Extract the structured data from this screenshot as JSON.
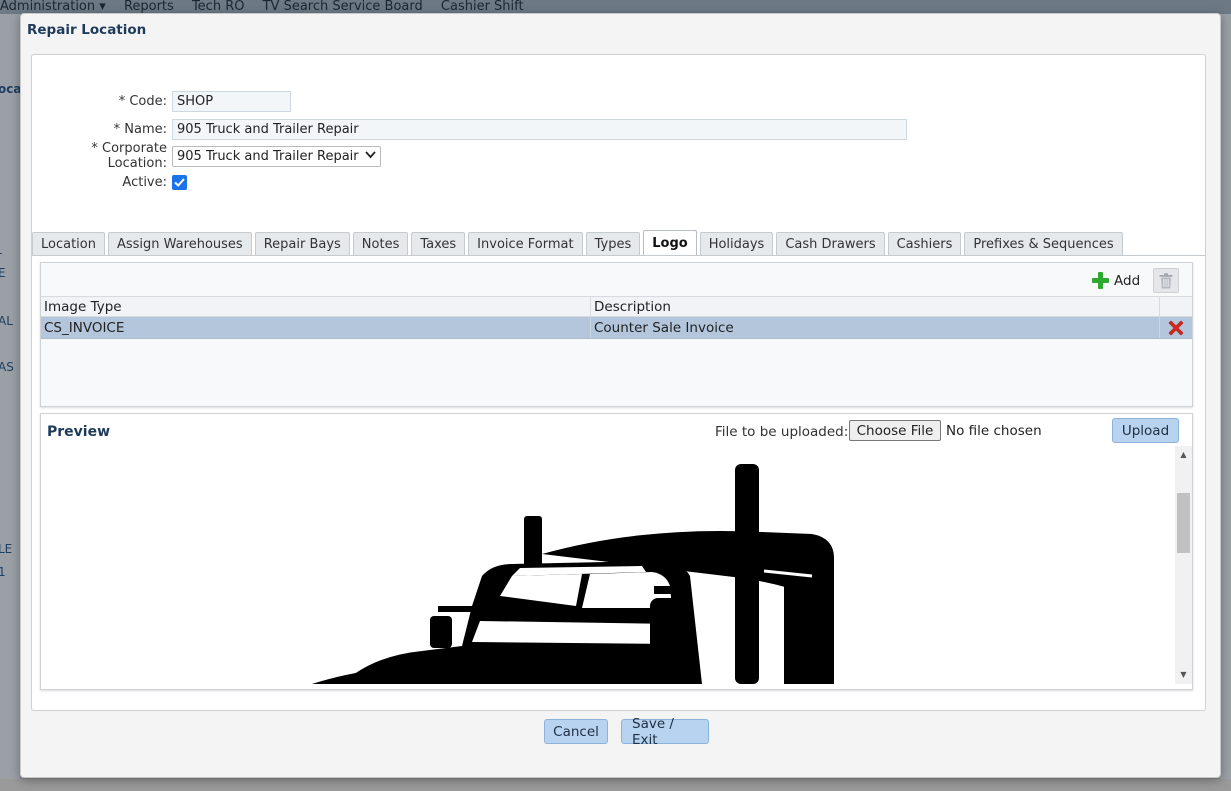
{
  "background": {
    "menu": [
      "Administration ▾",
      "Reports",
      "Tech RO",
      "TV Search Service Board",
      "Cashier Shift"
    ],
    "side_fragments": [
      "oca",
      "-",
      "E",
      "AL",
      "AS",
      "LE",
      "1"
    ]
  },
  "modal": {
    "title": "Repair Location"
  },
  "form": {
    "code": {
      "label": "* Code:",
      "value": "SHOP"
    },
    "name": {
      "label": "* Name:",
      "value": "905 Truck and Trailer Repair"
    },
    "corporate_location": {
      "label": "* Corporate Location:",
      "value": "905 Truck and Trailer Repair"
    },
    "active": {
      "label": "Active:",
      "checked": true
    }
  },
  "tabs": [
    {
      "label": "Location",
      "active": false
    },
    {
      "label": "Assign Warehouses",
      "active": false
    },
    {
      "label": "Repair Bays",
      "active": false
    },
    {
      "label": "Notes",
      "active": false
    },
    {
      "label": "Taxes",
      "active": false
    },
    {
      "label": "Invoice Format",
      "active": false
    },
    {
      "label": "Types",
      "active": false
    },
    {
      "label": "Logo",
      "active": true
    },
    {
      "label": "Holidays",
      "active": false
    },
    {
      "label": "Cash Drawers",
      "active": false
    },
    {
      "label": "Cashiers",
      "active": false
    },
    {
      "label": "Prefixes & Sequences",
      "active": false
    }
  ],
  "logo_grid": {
    "add_label": "Add",
    "columns": [
      "Image Type",
      "Description"
    ],
    "rows": [
      {
        "image_type": "CS_INVOICE",
        "description": "Counter Sale Invoice"
      }
    ]
  },
  "preview": {
    "title": "Preview",
    "upload_label": "File to be uploaded:",
    "choose_file": "Choose File",
    "no_file": "No file chosen",
    "upload_button": "Upload"
  },
  "footer": {
    "cancel": "Cancel",
    "save_exit": "Save / Exit"
  },
  "colors": {
    "accent": "#b8d3ef",
    "title": "#1f3b5c",
    "selected_row": "#b4c6dc",
    "add_icon": "#2ea82e",
    "delete_icon": "#d9291c"
  }
}
